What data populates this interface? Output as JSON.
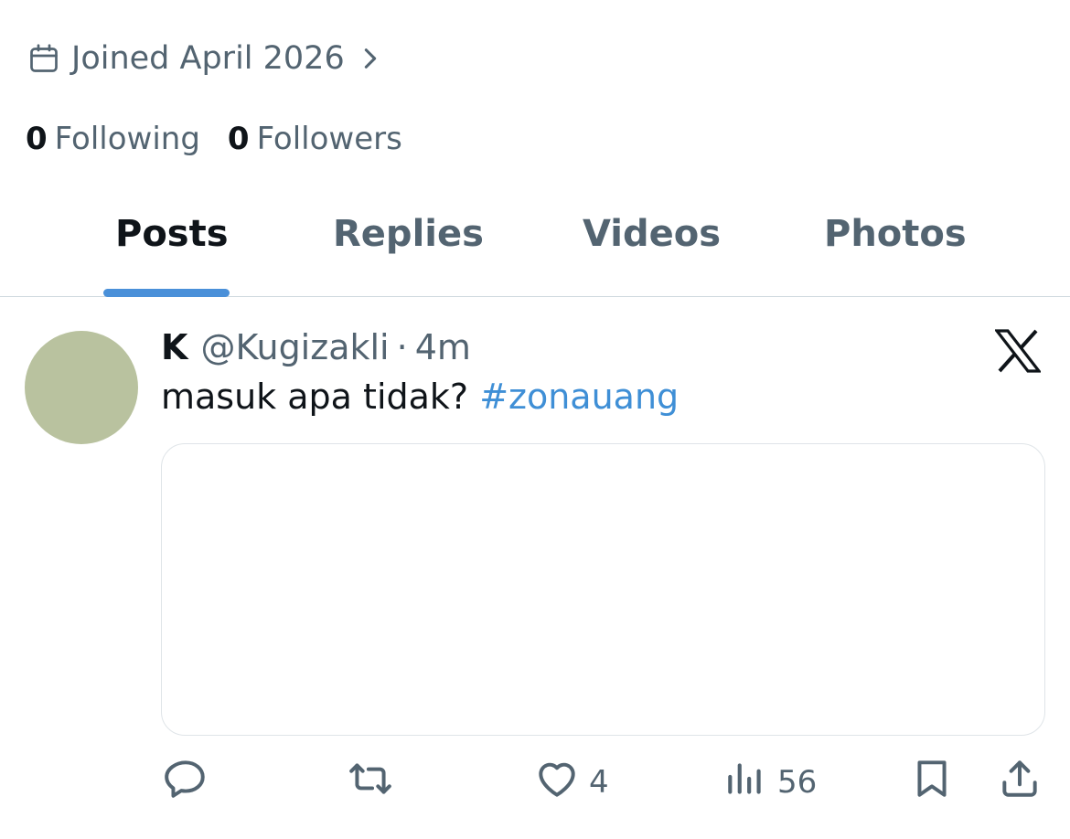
{
  "profile": {
    "joined_text": "Joined April 2026",
    "following_count": "0",
    "following_label": "Following",
    "followers_count": "0",
    "followers_label": "Followers"
  },
  "tabs": [
    {
      "label": "Posts",
      "active": true
    },
    {
      "label": "Replies",
      "active": false
    },
    {
      "label": "Videos",
      "active": false
    },
    {
      "label": "Photos",
      "active": false
    }
  ],
  "post": {
    "name": "K",
    "handle": "@Kugizakli",
    "separator": "·",
    "time": "4m",
    "text": "masuk apa tidak?",
    "hashtag": "#zonauang",
    "likes": "4",
    "views": "56"
  },
  "colors": {
    "accent": "#1d9bf0",
    "text_secondary": "#536471",
    "avatar": "#b9c29f"
  },
  "icons": [
    "calendar-icon",
    "chevron-right-icon",
    "x-logo-icon",
    "reply-icon",
    "repost-icon",
    "like-icon",
    "views-icon",
    "bookmark-icon",
    "share-icon"
  ]
}
